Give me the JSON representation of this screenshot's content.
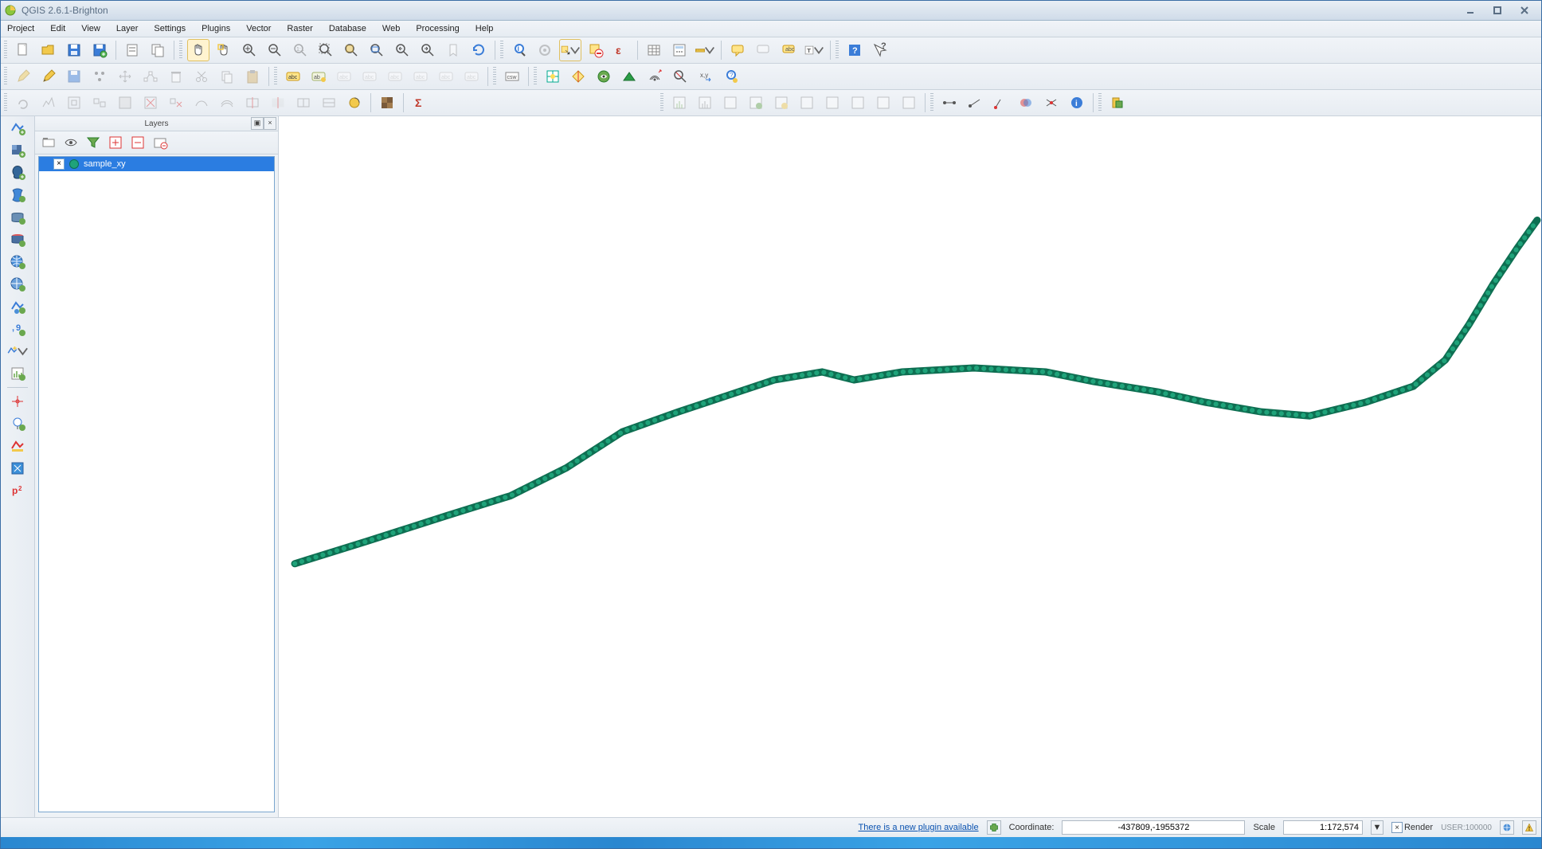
{
  "window": {
    "title": "QGIS 2.6.1-Brighton"
  },
  "menus": [
    "Project",
    "Edit",
    "View",
    "Layer",
    "Settings",
    "Plugins",
    "Vector",
    "Raster",
    "Database",
    "Web",
    "Processing",
    "Help"
  ],
  "layers_panel": {
    "title": "Layers",
    "items": [
      {
        "name": "sample_xy",
        "visible": true
      }
    ]
  },
  "status": {
    "plugin_notice": "There is a new plugin available",
    "coord_label": "Coordinate:",
    "coord_value": "-437809,-1955372",
    "scale_label": "Scale",
    "scale_value": "1:172,574",
    "render_label": "Render",
    "render_checked": true,
    "user_label": "USER:100000"
  },
  "icons": {
    "new": "new-project-icon",
    "open": "open-icon",
    "save": "save-icon"
  }
}
